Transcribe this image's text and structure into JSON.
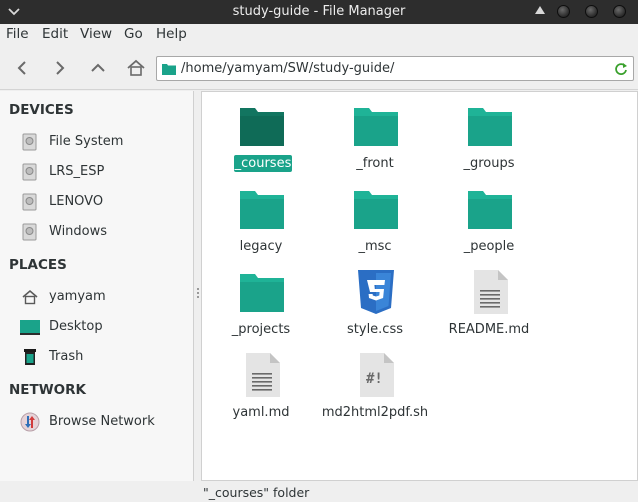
{
  "window": {
    "title": "study-guide - File Manager"
  },
  "menubar": {
    "items": [
      "File",
      "Edit",
      "View",
      "Go",
      "Help"
    ]
  },
  "toolbar": {
    "back_icon": "back-arrow-icon",
    "forward_icon": "forward-arrow-icon",
    "up_icon": "up-arrow-icon",
    "home_icon": "home-icon",
    "location_path": "/home/yamyam/SW/study-guide/"
  },
  "sidebar": {
    "devices_header": "DEVICES",
    "devices": [
      {
        "label": "File System",
        "icon": "hard-drive-icon"
      },
      {
        "label": "LRS_ESP",
        "icon": "hard-drive-icon"
      },
      {
        "label": "LENOVO",
        "icon": "hard-drive-icon"
      },
      {
        "label": "Windows",
        "icon": "hard-drive-icon"
      }
    ],
    "places_header": "PLACES",
    "places": [
      {
        "label": "yamyam",
        "icon": "home-icon"
      },
      {
        "label": "Desktop",
        "icon": "desktop-icon"
      },
      {
        "label": "Trash",
        "icon": "trash-icon"
      }
    ],
    "network_header": "NETWORK",
    "network": [
      {
        "label": "Browse Network",
        "icon": "network-icon"
      }
    ]
  },
  "files": [
    {
      "name": "_courses",
      "type": "folder",
      "selected": true
    },
    {
      "name": "_front",
      "type": "folder"
    },
    {
      "name": "_groups",
      "type": "folder"
    },
    {
      "name": "legacy",
      "type": "folder"
    },
    {
      "name": "_msc",
      "type": "folder"
    },
    {
      "name": "_people",
      "type": "folder"
    },
    {
      "name": "_projects",
      "type": "folder"
    },
    {
      "name": "style.css",
      "type": "css"
    },
    {
      "name": "README.md",
      "type": "text"
    },
    {
      "name": "yaml.md",
      "type": "text"
    },
    {
      "name": "md2html2pdf.sh",
      "type": "script"
    }
  ],
  "statusbar": {
    "text": "\"_courses\" folder"
  },
  "colors": {
    "accent": "#1aa38a",
    "folder": "#1fb397",
    "folder_selected": "#127560",
    "titlebar": "#2d2d2d"
  }
}
